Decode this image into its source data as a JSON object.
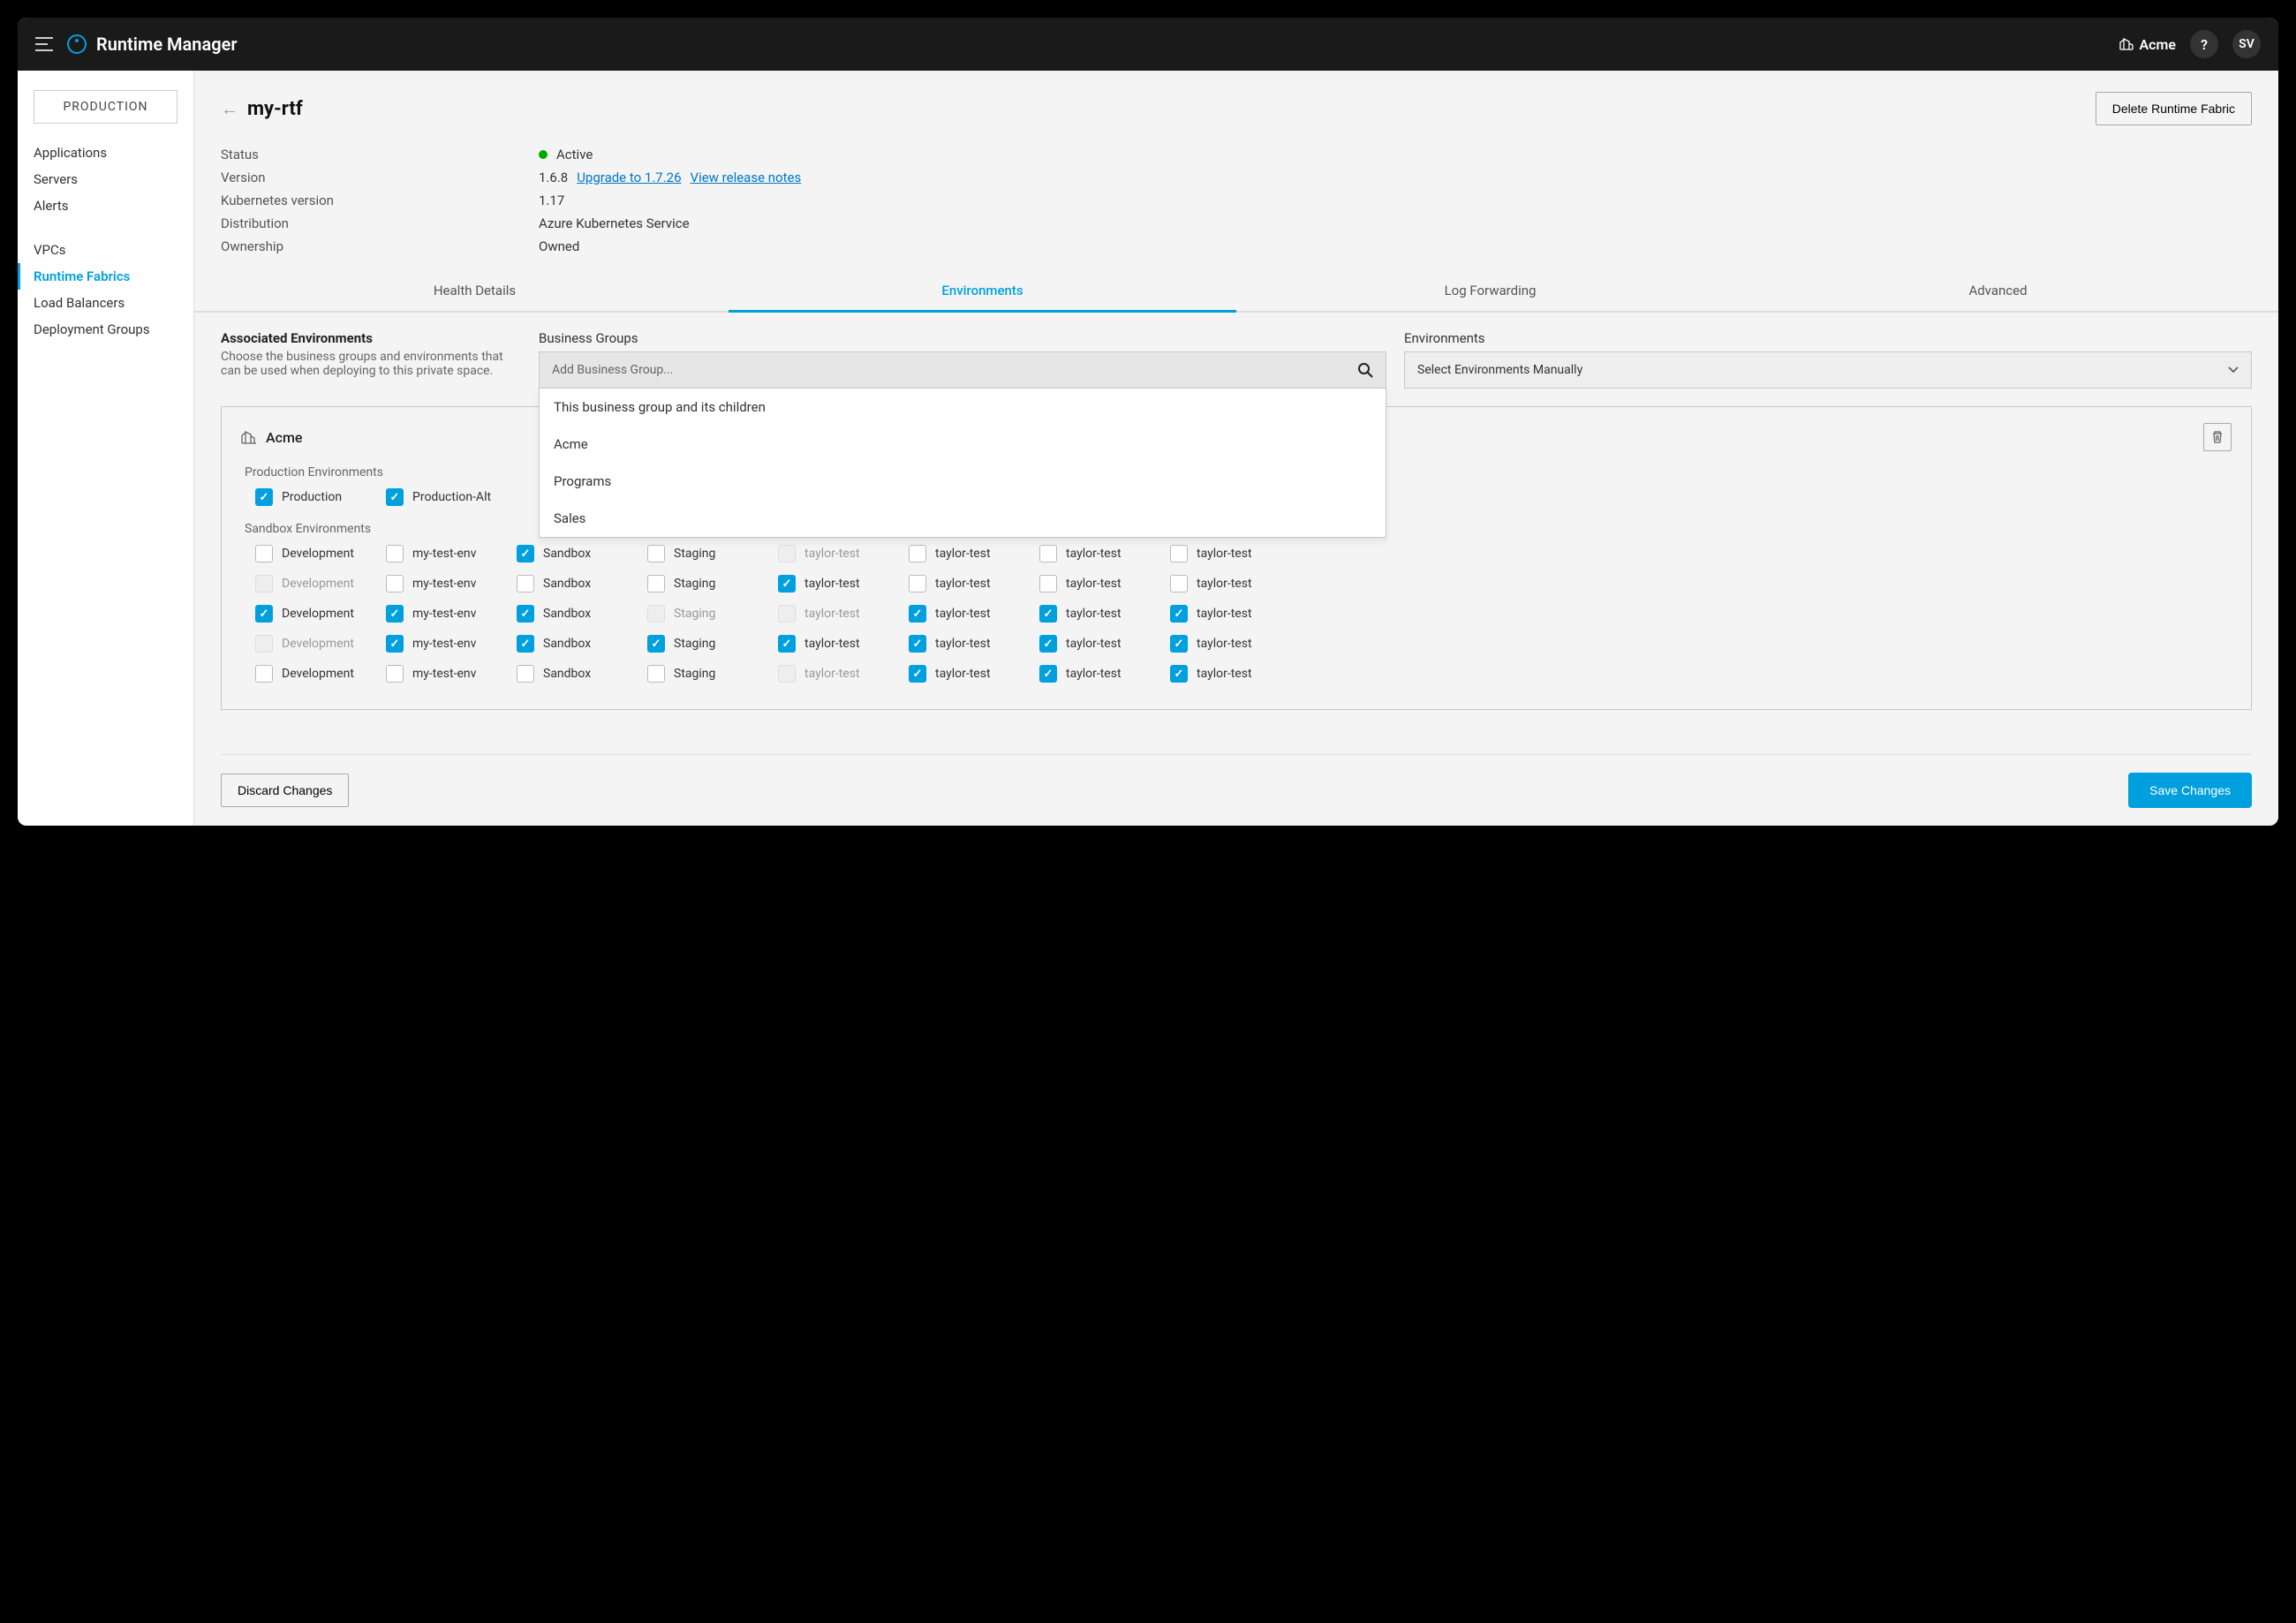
{
  "header": {
    "app_title": "Runtime Manager",
    "org_name": "Acme",
    "help_label": "?",
    "user_initials": "SV"
  },
  "sidebar": {
    "env_badge": "PRODUCTION",
    "group1": [
      "Applications",
      "Servers",
      "Alerts"
    ],
    "group2": [
      "VPCs",
      "Runtime Fabrics",
      "Load Balancers",
      "Deployment Groups"
    ],
    "active": "Runtime Fabrics"
  },
  "page": {
    "title": "my-rtf",
    "delete_label": "Delete Runtime Fabric",
    "details": {
      "status_label": "Status",
      "status_value": "Active",
      "version_label": "Version",
      "version_value": "1.6.8",
      "upgrade_link": "Upgrade to 1.7.26",
      "release_notes_link": "View release notes",
      "k8s_label": "Kubernetes version",
      "k8s_value": "1.17",
      "distribution_label": "Distribution",
      "distribution_value": "Azure Kubernetes Service",
      "ownership_label": "Ownership",
      "ownership_value": "Owned"
    }
  },
  "tabs": [
    "Health Details",
    "Environments",
    "Log Forwarding",
    "Advanced"
  ],
  "active_tab": "Environments",
  "env_section": {
    "title": "Associated Environments",
    "subtitle": "Choose the business groups and environments that can be used when deploying to this private space.",
    "bg_label": "Business Groups",
    "bg_placeholder": "Add Business Group...",
    "env_label": "Environments",
    "env_select_label": "Select Environments Manually",
    "dropdown_items": [
      "This business group and its children",
      "Acme",
      "Programs",
      "Sales"
    ]
  },
  "group_card": {
    "name": "Acme",
    "prod_header": "Production Environments",
    "sandbox_header": "Sandbox Environments",
    "prod_envs": [
      {
        "label": "Production",
        "checked": true
      },
      {
        "label": "Production-Alt",
        "checked": true
      }
    ],
    "sandbox_rows": [
      [
        {
          "label": "Development",
          "checked": false,
          "disabled": false
        },
        {
          "label": "my-test-env",
          "checked": false,
          "disabled": false
        },
        {
          "label": "Sandbox",
          "checked": true,
          "disabled": false
        },
        {
          "label": "Staging",
          "checked": false,
          "disabled": false
        },
        {
          "label": "taylor-test",
          "checked": false,
          "disabled": true
        },
        {
          "label": "taylor-test",
          "checked": false,
          "disabled": false
        },
        {
          "label": "taylor-test",
          "checked": false,
          "disabled": false
        },
        {
          "label": "taylor-test",
          "checked": false,
          "disabled": false
        }
      ],
      [
        {
          "label": "Development",
          "checked": false,
          "disabled": true
        },
        {
          "label": "my-test-env",
          "checked": false,
          "disabled": false
        },
        {
          "label": "Sandbox",
          "checked": false,
          "disabled": false
        },
        {
          "label": "Staging",
          "checked": false,
          "disabled": false
        },
        {
          "label": "taylor-test",
          "checked": true,
          "disabled": false
        },
        {
          "label": "taylor-test",
          "checked": false,
          "disabled": false
        },
        {
          "label": "taylor-test",
          "checked": false,
          "disabled": false
        },
        {
          "label": "taylor-test",
          "checked": false,
          "disabled": false
        }
      ],
      [
        {
          "label": "Development",
          "checked": true,
          "disabled": false
        },
        {
          "label": "my-test-env",
          "checked": true,
          "disabled": false
        },
        {
          "label": "Sandbox",
          "checked": true,
          "disabled": false
        },
        {
          "label": "Staging",
          "checked": false,
          "disabled": true
        },
        {
          "label": "taylor-test",
          "checked": false,
          "disabled": true
        },
        {
          "label": "taylor-test",
          "checked": true,
          "disabled": false
        },
        {
          "label": "taylor-test",
          "checked": true,
          "disabled": false
        },
        {
          "label": "taylor-test",
          "checked": true,
          "disabled": false
        }
      ],
      [
        {
          "label": "Development",
          "checked": false,
          "disabled": true
        },
        {
          "label": "my-test-env",
          "checked": true,
          "disabled": false
        },
        {
          "label": "Sandbox",
          "checked": true,
          "disabled": false
        },
        {
          "label": "Staging",
          "checked": true,
          "disabled": false
        },
        {
          "label": "taylor-test",
          "checked": true,
          "disabled": false
        },
        {
          "label": "taylor-test",
          "checked": true,
          "disabled": false
        },
        {
          "label": "taylor-test",
          "checked": true,
          "disabled": false
        },
        {
          "label": "taylor-test",
          "checked": true,
          "disabled": false
        }
      ],
      [
        {
          "label": "Development",
          "checked": false,
          "disabled": false
        },
        {
          "label": "my-test-env",
          "checked": false,
          "disabled": false
        },
        {
          "label": "Sandbox",
          "checked": false,
          "disabled": false
        },
        {
          "label": "Staging",
          "checked": false,
          "disabled": false
        },
        {
          "label": "taylor-test",
          "checked": false,
          "disabled": true
        },
        {
          "label": "taylor-test",
          "checked": true,
          "disabled": false
        },
        {
          "label": "taylor-test",
          "checked": true,
          "disabled": false
        },
        {
          "label": "taylor-test",
          "checked": true,
          "disabled": false
        }
      ]
    ]
  },
  "footer": {
    "discard": "Discard Changes",
    "save": "Save Changes"
  }
}
